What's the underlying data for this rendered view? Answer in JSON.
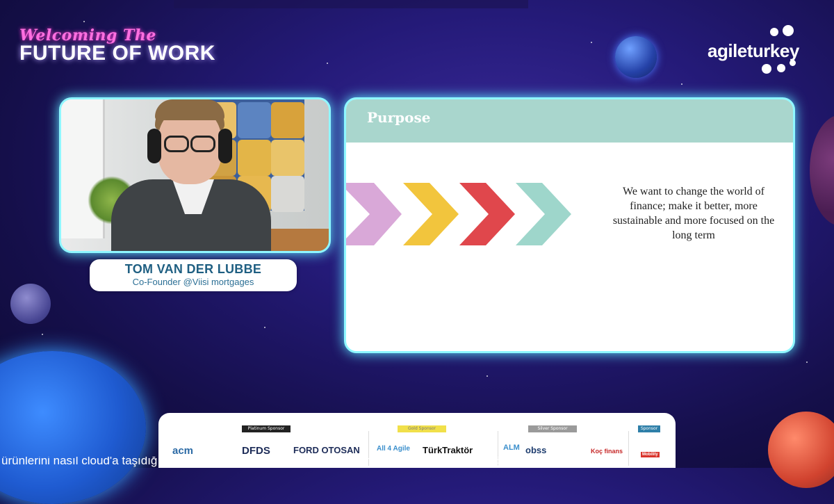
{
  "event": {
    "script_title": "Welcoming The",
    "main_title": "FUTURE OF WORK"
  },
  "logo": {
    "text": "agileturkey"
  },
  "speaker": {
    "name": "TOM VAN DER LUBBE",
    "role": "Co-Founder @Viisi mortgages"
  },
  "slide": {
    "title": "Purpose",
    "body": "We want to change the world of finance; make it better, more sustainable and more focused on the long term",
    "chevron_colors": [
      "#d9a8d8",
      "#f2c53d",
      "#e0474c",
      "#9ed6cb"
    ]
  },
  "sponsors": {
    "tiers": [
      {
        "label": "Platinum Sponsor",
        "color": "#222222"
      },
      {
        "label": "Gold Sponsor",
        "color": "#f1e04a"
      },
      {
        "label": "Silver Sponsor",
        "color": "#9a9a9a"
      },
      {
        "label": "Sponsor",
        "color": "#2e7fa8"
      }
    ],
    "logos": [
      "acm",
      "DFDS",
      "FORD OTOSAN",
      "All 4 Agile",
      "TürkTraktör",
      "ALM",
      "obss",
      "Koç finans",
      "Mobility"
    ]
  },
  "ticker": {
    "text": "ürünlerini nasıl cloud'a taşıdığımızı tüm detaylarıyla konuşacağız. Herhangi bir sorunuz veya öğrenmek istediğiniz bir bil"
  }
}
